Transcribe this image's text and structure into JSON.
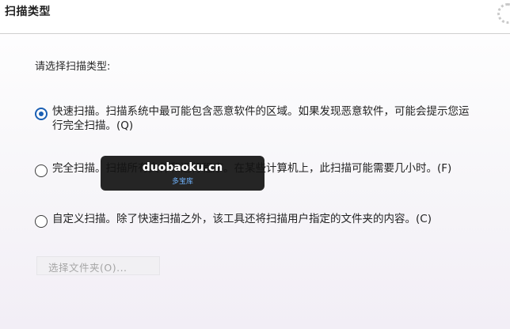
{
  "header": {
    "title": "扫描类型"
  },
  "prompt": "请选择扫描类型:",
  "options": [
    {
      "label": "快速扫描。扫描系统中最可能包含恶意软件的区域。如果发现恶意软件，可能会提示您运行完全扫描。(Q)",
      "selected": true
    },
    {
      "label": "完全扫描。扫描所有文件和运行程序。在某些计算机上，此扫描可能需要几小时。(F)",
      "selected": false
    },
    {
      "label": "自定义扫描。除了快速扫描之外，该工具还将扫描用户指定的文件夹的内容。(C)",
      "selected": false
    }
  ],
  "browse_button": {
    "label": "选择文件夹(O)...",
    "enabled": false
  },
  "watermark": {
    "main": "duobaoku.cn",
    "sub": "多宝库"
  },
  "colors": {
    "accent": "#1a5fb4",
    "disabled_text": "#a5a5a5"
  }
}
